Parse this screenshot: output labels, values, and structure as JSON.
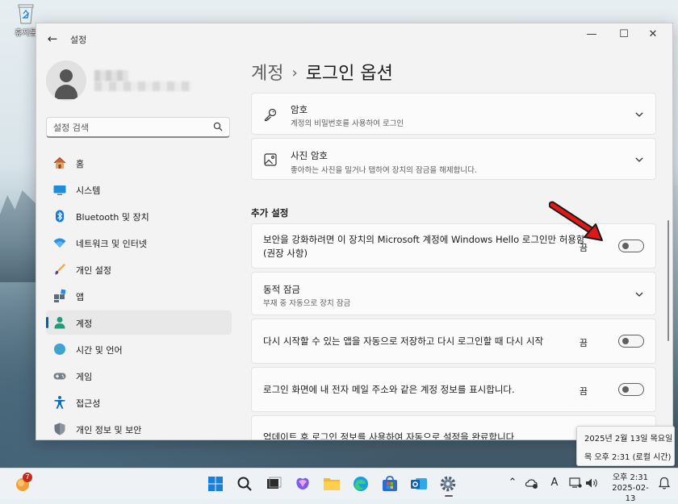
{
  "desktop": {
    "recycle_bin_label": "휴지통"
  },
  "window": {
    "title": "설정",
    "controls": {
      "minimize": "—",
      "maximize": "☐",
      "close": "✕"
    }
  },
  "sidebar": {
    "search_placeholder": "설정 검색",
    "items": [
      {
        "label": "홈",
        "icon": "home-icon"
      },
      {
        "label": "시스템",
        "icon": "system-icon"
      },
      {
        "label": "Bluetooth 및 장치",
        "icon": "bluetooth-icon"
      },
      {
        "label": "네트워크 및 인터넷",
        "icon": "wifi-icon"
      },
      {
        "label": "개인 설정",
        "icon": "brush-icon"
      },
      {
        "label": "앱",
        "icon": "apps-icon"
      },
      {
        "label": "계정",
        "icon": "account-icon",
        "active": true
      },
      {
        "label": "시간 및 언어",
        "icon": "globe-icon"
      },
      {
        "label": "게임",
        "icon": "gamepad-icon"
      },
      {
        "label": "접근성",
        "icon": "accessibility-icon"
      },
      {
        "label": "개인 정보 및 보안",
        "icon": "shield-icon"
      }
    ]
  },
  "breadcrumb": {
    "parent": "계정",
    "separator": "›",
    "current": "로그인 옵션"
  },
  "main": {
    "password": {
      "title": "암호",
      "subtitle": "계정의 비밀번호를 사용하여 로그인"
    },
    "picture_password": {
      "title": "사진 암호",
      "subtitle": "좋아하는 사진을 밀거나 탭하여 장치의 잠금을 해제합니다."
    },
    "additional_settings_heading": "추가 설정",
    "hello_only": {
      "text": "보안을 강화하려면 이 장치의 Microsoft 계정에 Windows Hello 로그인만 허용함 (권장 사항)",
      "state": "끔",
      "on": false
    },
    "dynamic_lock": {
      "title": "동적 잠금",
      "subtitle": "부재 중 자동으로 장치 잠금"
    },
    "restart_apps": {
      "text": "다시 시작할 수 있는 앱을 자동으로 저장하고 다시 로그인할 때 다시 시작",
      "state": "끔",
      "on": false
    },
    "show_account_details": {
      "text": "로그인 화면에 내 전자 메일 주소와 같은 계정 정보를 표시합니다.",
      "state": "끔",
      "on": false
    },
    "auto_finish_setup": {
      "text": "업데이트 후 로그인 정보를 사용하여 자동으로 설정을 완료합니다"
    }
  },
  "tooltip": {
    "date": "2025년 2월 13일 목요일",
    "time": "목 오후 2:31 (로컬 시간)"
  },
  "taskbar": {
    "badge_count": "7",
    "clock_time": "오후 2:31",
    "clock_date": "2025-02-13",
    "ime_label": "A"
  }
}
